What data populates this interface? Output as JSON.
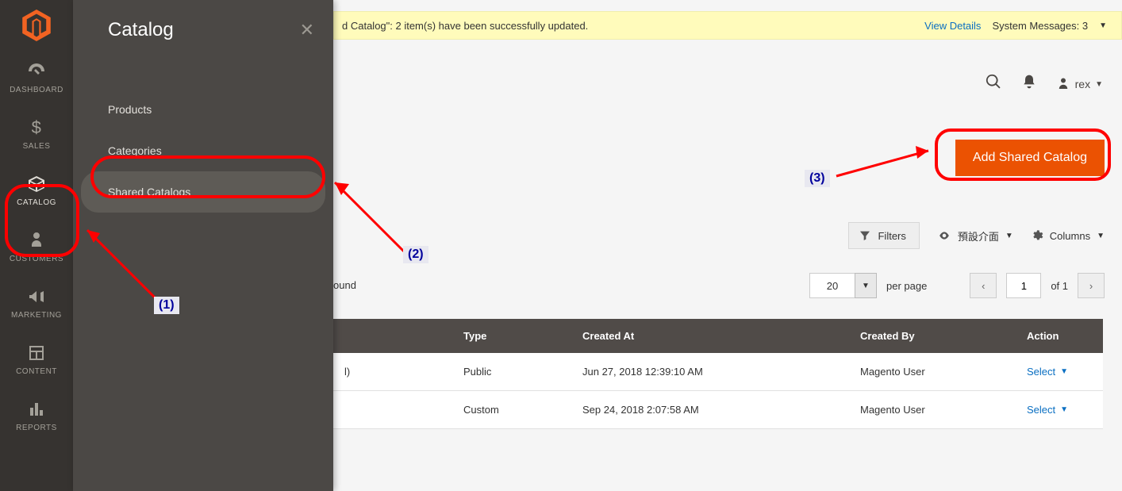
{
  "rail": {
    "items": [
      {
        "label": "DASHBOARD"
      },
      {
        "label": "SALES"
      },
      {
        "label": "CATALOG"
      },
      {
        "label": "CUSTOMERS"
      },
      {
        "label": "MARKETING"
      },
      {
        "label": "CONTENT"
      },
      {
        "label": "REPORTS"
      }
    ]
  },
  "flyout": {
    "title": "Catalog",
    "items": [
      {
        "label": "Products"
      },
      {
        "label": "Categories"
      },
      {
        "label": "Shared Catalogs"
      }
    ]
  },
  "sysbar": {
    "message": "d Catalog\": 2 item(s) have been successfully updated.",
    "view_details": "View Details",
    "system_messages": "System Messages: 3"
  },
  "header": {
    "username": "rex"
  },
  "page": {
    "add_button": "Add Shared Catalog",
    "filters": "Filters",
    "default_view": "預設介面",
    "columns": "Columns",
    "found_suffix": "ound",
    "page_size": "20",
    "per_page": "per page",
    "page_number": "1",
    "of_total": "of 1"
  },
  "table": {
    "headers": {
      "type": "Type",
      "created_at": "Created At",
      "created_by": "Created By",
      "action": "Action"
    },
    "rows": [
      {
        "name_suffix": "l)",
        "type": "Public",
        "created_at": "Jun 27, 2018 12:39:10 AM",
        "created_by": "Magento User",
        "action": "Select"
      },
      {
        "name_suffix": "",
        "type": "Custom",
        "created_at": "Sep 24, 2018 2:07:58 AM",
        "created_by": "Magento User",
        "action": "Select"
      }
    ]
  },
  "annotations": {
    "a1": "(1)",
    "a2": "(2)",
    "a3": "(3)"
  }
}
